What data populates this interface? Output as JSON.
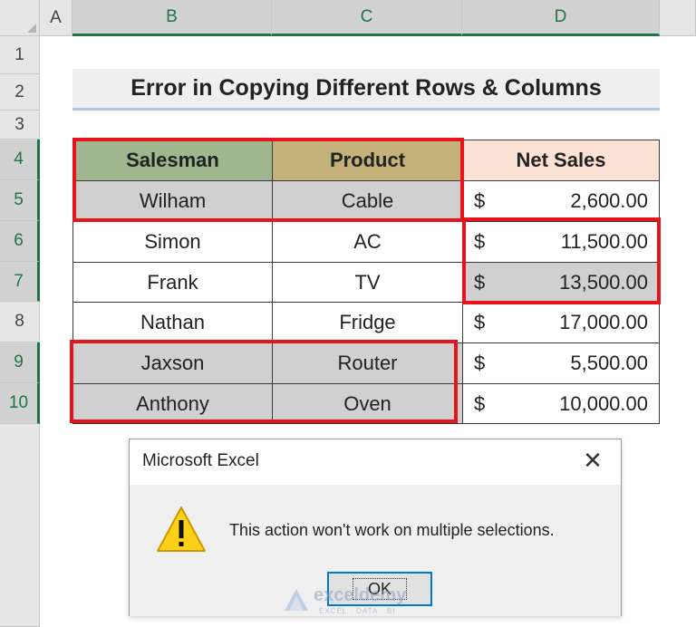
{
  "columns": [
    "A",
    "B",
    "C",
    "D"
  ],
  "rows": [
    "1",
    "2",
    "3",
    "4",
    "5",
    "6",
    "7",
    "8",
    "9",
    "10"
  ],
  "title": "Error in Copying Different Rows & Columns",
  "table": {
    "headers": [
      "Salesman",
      "Product",
      "Net Sales"
    ],
    "rows": [
      {
        "salesman": "Wilham",
        "product": "Cable",
        "currency": "$",
        "amount": "2,600.00"
      },
      {
        "salesman": "Simon",
        "product": "AC",
        "currency": "$",
        "amount": "11,500.00"
      },
      {
        "salesman": "Frank",
        "product": "TV",
        "currency": "$",
        "amount": "13,500.00"
      },
      {
        "salesman": "Nathan",
        "product": "Fridge",
        "currency": "$",
        "amount": "17,000.00"
      },
      {
        "salesman": "Jaxson",
        "product": "Router",
        "currency": "$",
        "amount": "5,500.00"
      },
      {
        "salesman": "Anthony",
        "product": "Oven",
        "currency": "$",
        "amount": "10,000.00"
      }
    ]
  },
  "dialog": {
    "title": "Microsoft Excel",
    "close": "✕",
    "message": "This action won't work on multiple selections.",
    "ok_label": "OK"
  },
  "watermark": {
    "brand": "exceldemy",
    "tagline": "EXCEL · DATA · BI"
  },
  "colors": {
    "header_salesman": "#9fb68f",
    "header_product": "#c5b17a",
    "header_netsales": "#fbe2d5",
    "selection_gray": "#d0d0d0",
    "red_outline": "#e8131b",
    "excel_green": "#217346"
  }
}
